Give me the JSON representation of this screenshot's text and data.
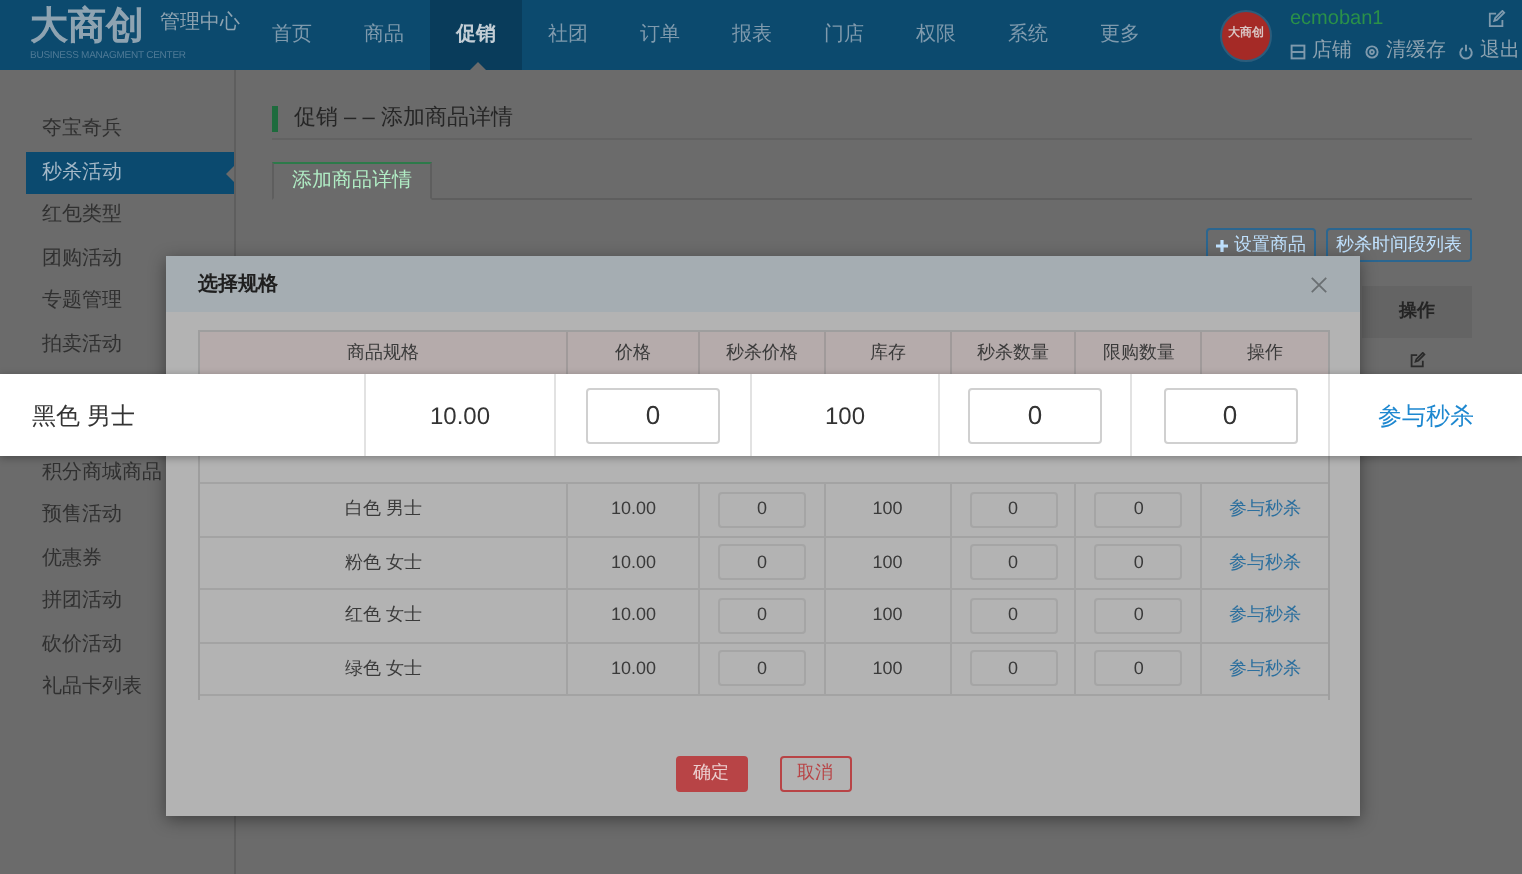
{
  "top_bar": {
    "logo": "大商创",
    "logo_subtitle": "管理中心",
    "logo_tagline": "BUSINESS MANAGMENT CENTER",
    "nav": [
      {
        "label": "首页",
        "selected": false
      },
      {
        "label": "商品",
        "selected": false
      },
      {
        "label": "促销",
        "selected": true
      },
      {
        "label": "社团",
        "selected": false
      },
      {
        "label": "订单",
        "selected": false
      },
      {
        "label": "报表",
        "selected": false
      },
      {
        "label": "门店",
        "selected": false
      },
      {
        "label": "权限",
        "selected": false
      },
      {
        "label": "系统",
        "selected": false
      },
      {
        "label": "更多",
        "selected": false
      }
    ],
    "avatar_text": "大商创",
    "username": "ecmoban1",
    "links": [
      {
        "label": "店铺",
        "kind": "store"
      },
      {
        "label": "清缓存",
        "kind": "settings"
      },
      {
        "label": "退出",
        "kind": "logout"
      }
    ]
  },
  "sidebar": {
    "items_above": [
      {
        "label": "夺宝奇兵",
        "selected": false
      },
      {
        "label": "秒杀活动",
        "selected": true
      },
      {
        "label": "红包类型",
        "selected": false
      },
      {
        "label": "团购活动",
        "selected": false
      },
      {
        "label": "专题管理",
        "selected": false
      },
      {
        "label": "拍卖活动",
        "selected": false
      }
    ],
    "items_below": [
      {
        "label": "积分商城商品",
        "selected": false
      },
      {
        "label": "预售活动",
        "selected": false
      },
      {
        "label": "优惠券",
        "selected": false
      },
      {
        "label": "拼团活动",
        "selected": false
      },
      {
        "label": "砍价活动",
        "selected": false
      },
      {
        "label": "礼品卡列表",
        "selected": false
      }
    ]
  },
  "page": {
    "title": "促销 – – 添加商品详情",
    "tabs": [
      {
        "label": "添加商品详情",
        "selected": true
      }
    ],
    "buttons": [
      {
        "label": "设置商品",
        "kind": "add"
      },
      {
        "label": "秒杀时间段列表",
        "kind": "plain"
      }
    ],
    "table_header": "操作"
  },
  "dialog": {
    "title": "选择规格",
    "columns": [
      "商品规格",
      "价格",
      "秒杀价格",
      "库存",
      "秒杀数量",
      "限购数量",
      "操作"
    ],
    "rows": [
      {
        "spec": "白色 男士",
        "price": "10.00",
        "seckill_price": "0",
        "stock": "100",
        "seckill_qty": "0",
        "limit_qty": "0",
        "action": "参与秒杀"
      },
      {
        "spec": "粉色 女士",
        "price": "10.00",
        "seckill_price": "0",
        "stock": "100",
        "seckill_qty": "0",
        "limit_qty": "0",
        "action": "参与秒杀"
      },
      {
        "spec": "红色 女士",
        "price": "10.00",
        "seckill_price": "0",
        "stock": "100",
        "seckill_qty": "0",
        "limit_qty": "0",
        "action": "参与秒杀"
      },
      {
        "spec": "绿色 女士",
        "price": "10.00",
        "seckill_price": "0",
        "stock": "100",
        "seckill_qty": "0",
        "limit_qty": "0",
        "action": "参与秒杀"
      }
    ],
    "buttons": [
      {
        "label": "确定",
        "kind": "primary"
      },
      {
        "label": "取消",
        "kind": "secondary"
      }
    ]
  },
  "highlight_row": {
    "spec": "黑色 男士",
    "price": "10.00",
    "seckill_price": "0",
    "stock": "100",
    "seckill_qty": "0",
    "limit_qty": "0",
    "action": "参与秒杀"
  }
}
